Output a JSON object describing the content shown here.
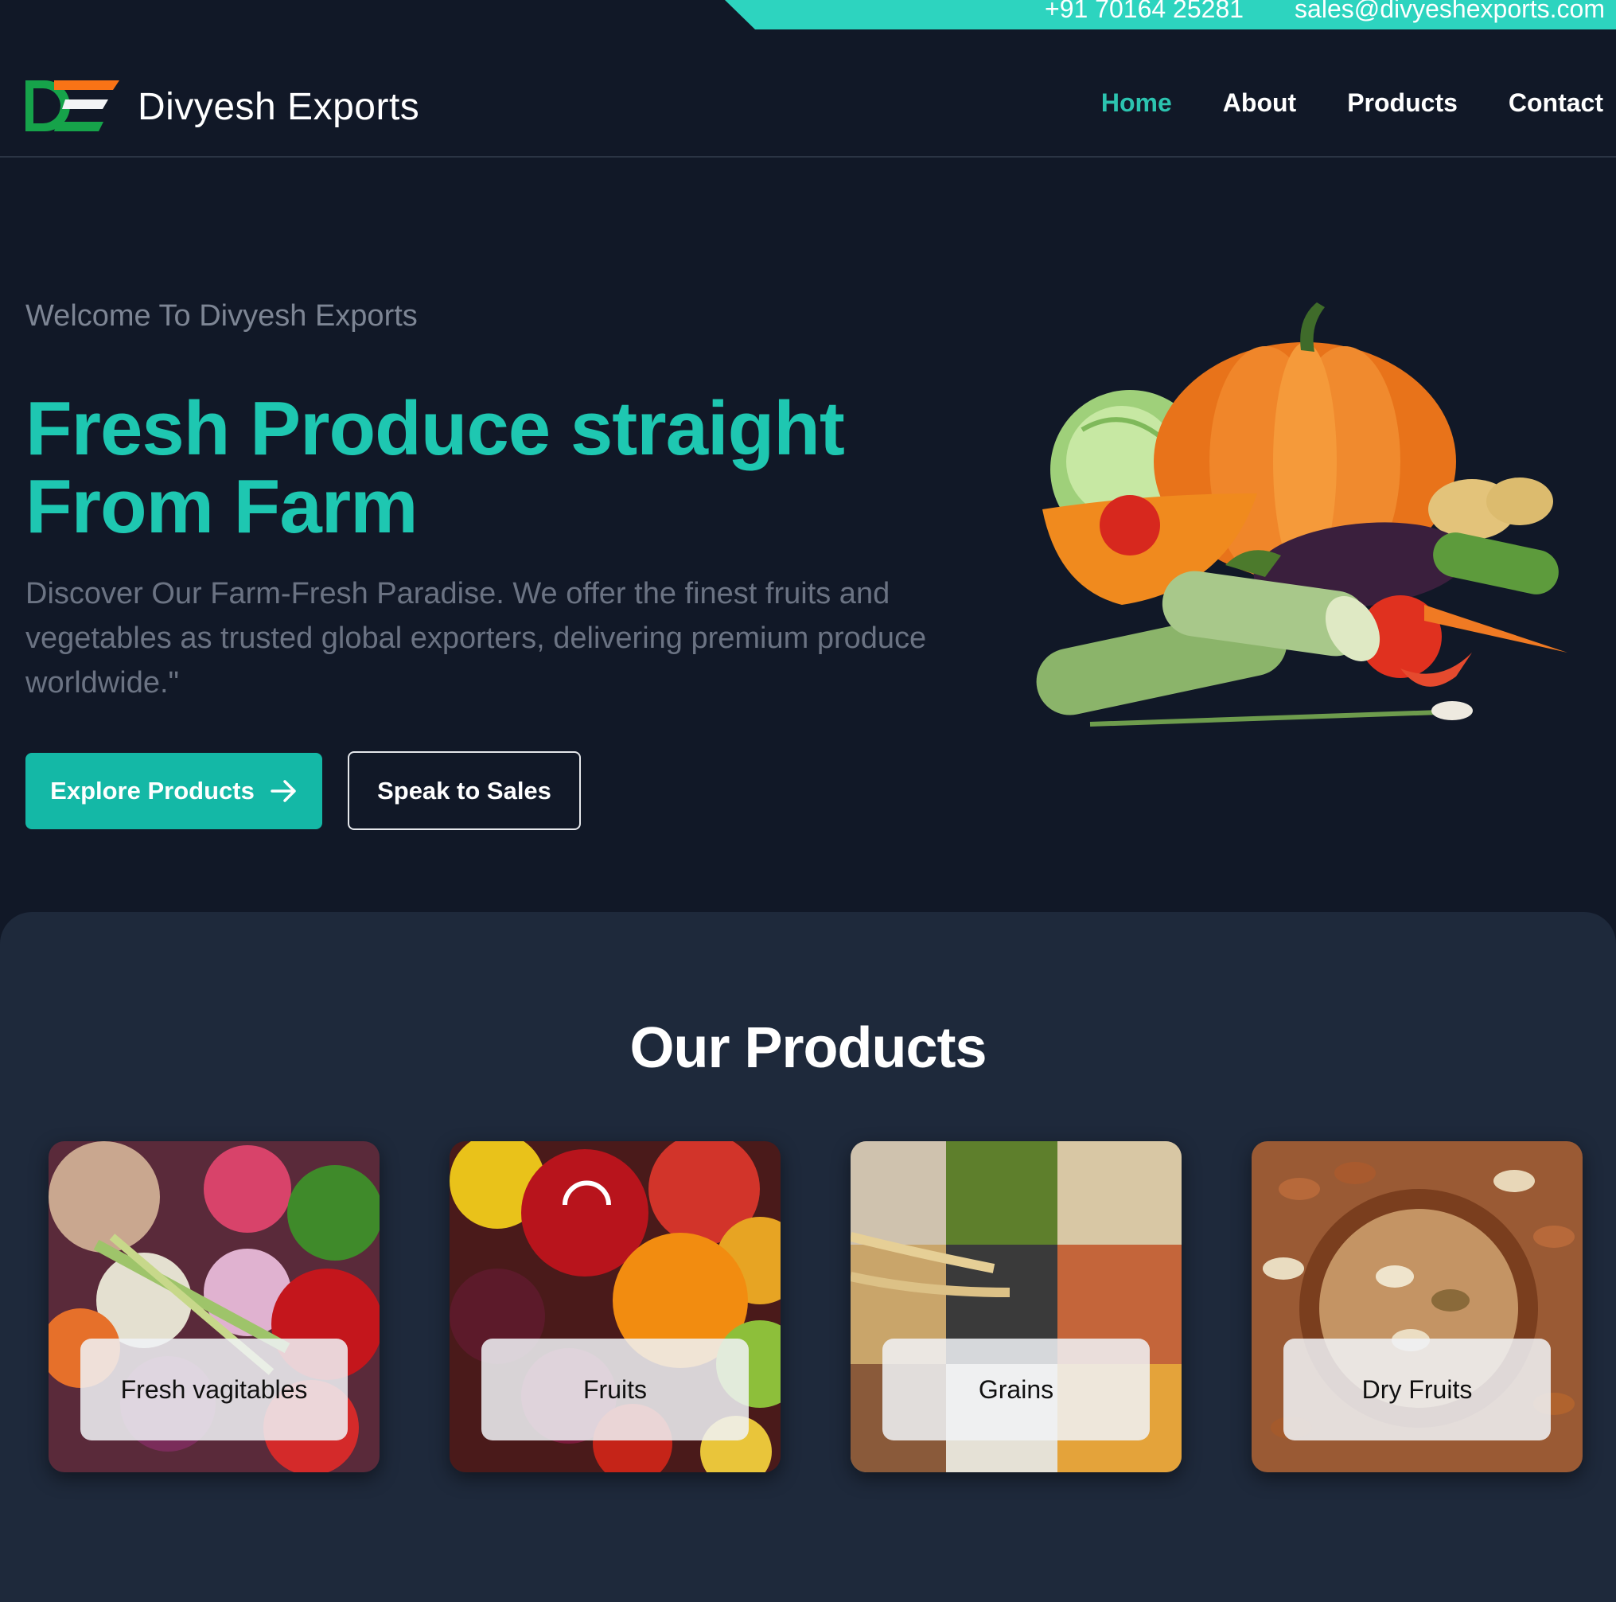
{
  "topbar": {
    "phone": "+91 70164 25281",
    "email": "sales@divyeshexports.com"
  },
  "header": {
    "brand": "Divyesh Exports",
    "logo_icon": "de-logo-icon",
    "nav": [
      {
        "label": "Home",
        "active": true
      },
      {
        "label": "About",
        "active": false
      },
      {
        "label": "Products",
        "active": false
      },
      {
        "label": "Contact",
        "active": false
      }
    ]
  },
  "hero": {
    "welcome": "Welcome To Divyesh Exports",
    "headline_line1": "Fresh Produce straight",
    "headline_line2": "From Farm",
    "description": "Discover Our Farm-Fresh Paradise. We offer the finest fruits and vegetables as trusted global exporters, delivering premium produce worldwide.\"",
    "primary_button": "Explore Products",
    "primary_button_icon": "arrow-right-icon",
    "secondary_button": "Speak to Sales",
    "image_icon": "vegetables-illustration"
  },
  "products": {
    "title": "Our Products",
    "cards": [
      {
        "label": "Fresh vagitables",
        "image_icon": "vegetables-photo"
      },
      {
        "label": "Fruits",
        "image_icon": "fruits-photo"
      },
      {
        "label": "Grains",
        "image_icon": "grains-photo"
      },
      {
        "label": "Dry Fruits",
        "image_icon": "dry-fruits-photo"
      }
    ]
  },
  "colors": {
    "background": "#111827",
    "section": "#1e293b",
    "accent": "#14b8a6",
    "topbar": "#2dd4bf",
    "headline": "#1ec7b1",
    "logo_orange": "#f97316",
    "logo_green": "#16a34a"
  }
}
